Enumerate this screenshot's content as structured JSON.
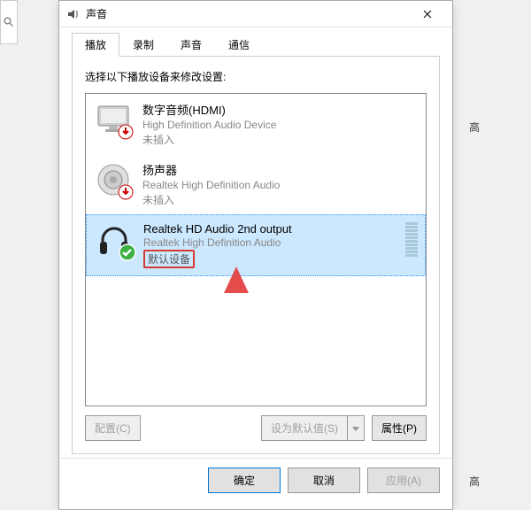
{
  "bg": {
    "line1": "高",
    "line2": "高"
  },
  "dialog": {
    "title": "声音",
    "tabs": [
      "播放",
      "录制",
      "声音",
      "通信"
    ],
    "instruction": "选择以下播放设备来修改设置:",
    "devices": [
      {
        "name": "数字音频(HDMI)",
        "desc": "High Definition Audio Device",
        "status": "未插入",
        "selected": false,
        "badge": "down",
        "type": "monitor"
      },
      {
        "name": "扬声器",
        "desc": "Realtek High Definition Audio",
        "status": "未插入",
        "selected": false,
        "badge": "down",
        "type": "speaker"
      },
      {
        "name": "Realtek HD Audio 2nd output",
        "desc": "Realtek High Definition Audio",
        "status": "默认设备",
        "selected": true,
        "badge": "check",
        "type": "headphone"
      }
    ],
    "buttons": {
      "configure": "配置(C)",
      "setDefault": "设为默认值(S)",
      "properties": "属性(P)"
    },
    "dialogButtons": {
      "ok": "确定",
      "cancel": "取消",
      "apply": "应用(A)"
    }
  }
}
